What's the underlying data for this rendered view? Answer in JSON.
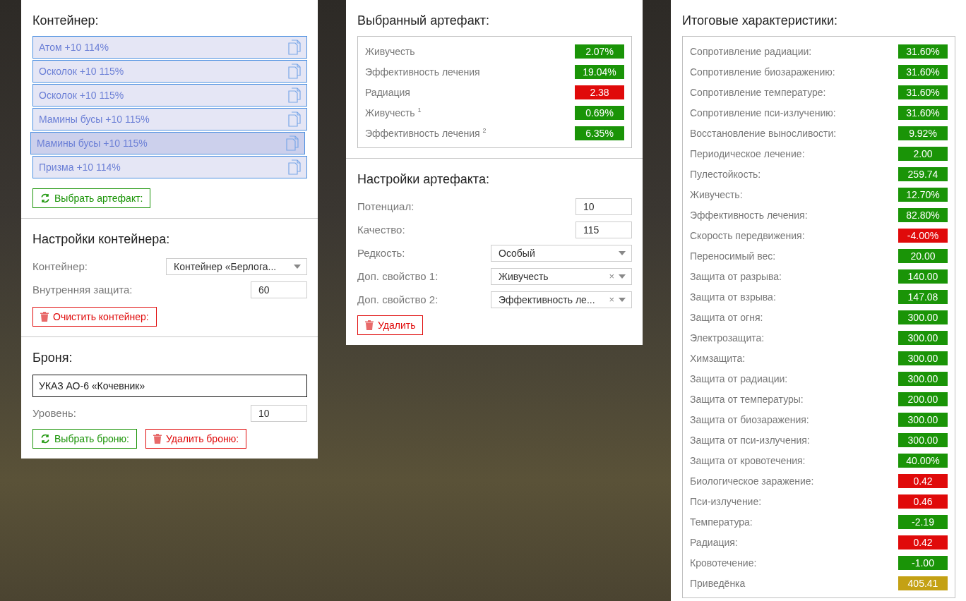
{
  "container": {
    "title": "Контейнер:",
    "artifacts": [
      {
        "label": "Атом +10 114%",
        "selected": false
      },
      {
        "label": "Осколок +10 115%",
        "selected": false
      },
      {
        "label": "Осколок +10 115%",
        "selected": false
      },
      {
        "label": "Мамины бусы +10 115%",
        "selected": false
      },
      {
        "label": "Мамины бусы +10 115%",
        "selected": true
      },
      {
        "label": "Призма +10 114%",
        "selected": false
      }
    ],
    "choose_button": "Выбрать артефакт:"
  },
  "container_settings": {
    "title": "Настройки контейнера:",
    "fields": [
      {
        "kind": "select",
        "label": "Контейнер:",
        "value": "Контейнер «Берлога..."
      },
      {
        "kind": "number",
        "label": "Внутренняя защита:",
        "value": "60"
      }
    ],
    "clear_button": "Очистить контейнер:"
  },
  "armor": {
    "title": "Броня:",
    "name": "УКАЗ АО-6 «Кочевник»",
    "level_label": "Уровень:",
    "level_value": "10",
    "choose_button": "Выбрать броню:",
    "delete_button": "Удалить броню:"
  },
  "selected_artifact": {
    "title": "Выбранный артефакт:",
    "stats": [
      {
        "label": "Живучесть",
        "value": "2.07%",
        "color": "#1a9407"
      },
      {
        "label": "Эффективность лечения",
        "value": "19.04%",
        "color": "#1a9407"
      },
      {
        "label": "Радиация",
        "value": "2.38",
        "color": "#e00a0a"
      },
      {
        "label": "Живучесть $^{1}$",
        "value": "0.69%",
        "color": "#1a9407"
      },
      {
        "label": "Эффективность лечения $^{2}$",
        "value": "6.35%",
        "color": "#1a9407"
      }
    ]
  },
  "artifact_settings": {
    "title": "Настройки артефакта:",
    "fields": [
      {
        "kind": "number",
        "label": "Потенциал:",
        "value": "10"
      },
      {
        "kind": "number",
        "label": "Качество:",
        "value": "115"
      },
      {
        "kind": "select",
        "label": "Редкость:",
        "value": "Особый"
      },
      {
        "kind": "clearable",
        "label": "Доп. свойство 1:",
        "value": "Живучесть",
        "clear": "×"
      },
      {
        "kind": "clearable",
        "label": "Доп. свойство 2:",
        "value": "Эффективность ле...",
        "clear": "×"
      }
    ],
    "delete_button": "Удалить"
  },
  "totals": {
    "title": "Итоговые характеристики:",
    "stats": [
      {
        "label": "Сопротивление радиации:",
        "value": "31.60%",
        "color": "#1a9407"
      },
      {
        "label": "Сопротивление биозаражению:",
        "value": "31.60%",
        "color": "#1a9407"
      },
      {
        "label": "Сопротивление температуре:",
        "value": "31.60%",
        "color": "#1a9407"
      },
      {
        "label": "Сопротивление пси-излучению:",
        "value": "31.60%",
        "color": "#1a9407"
      },
      {
        "label": "Восстановление выносливости:",
        "value": "9.92%",
        "color": "#1a9407"
      },
      {
        "label": "Периодическое лечение:",
        "value": "2.00",
        "color": "#1a9407"
      },
      {
        "label": "Пулестойкость:",
        "value": "259.74",
        "color": "#1a9407"
      },
      {
        "label": "Живучесть:",
        "value": "12.70%",
        "color": "#1a9407"
      },
      {
        "label": "Эффективность лечения:",
        "value": "82.80%",
        "color": "#1a9407"
      },
      {
        "label": "Скорость передвижения:",
        "value": "-4.00%",
        "color": "#e00a0a"
      },
      {
        "label": "Переносимый вес:",
        "value": "20.00",
        "color": "#1a9407"
      },
      {
        "label": "Защита от разрыва:",
        "value": "140.00",
        "color": "#1a9407"
      },
      {
        "label": "Защита от взрыва:",
        "value": "147.08",
        "color": "#1a9407"
      },
      {
        "label": "Защита от огня:",
        "value": "300.00",
        "color": "#1a9407"
      },
      {
        "label": "Электрозащита:",
        "value": "300.00",
        "color": "#1a9407"
      },
      {
        "label": "Химзащита:",
        "value": "300.00",
        "color": "#1a9407"
      },
      {
        "label": "Защита от радиации:",
        "value": "300.00",
        "color": "#1a9407"
      },
      {
        "label": "Защита от температуры:",
        "value": "200.00",
        "color": "#1a9407"
      },
      {
        "label": "Защита от биозаражения:",
        "value": "300.00",
        "color": "#1a9407"
      },
      {
        "label": "Защита от пси-излучения:",
        "value": "300.00",
        "color": "#1a9407"
      },
      {
        "label": "Защита от кровотечения:",
        "value": "40.00%",
        "color": "#1a9407"
      },
      {
        "label": "Биологическое заражение:",
        "value": "0.42",
        "color": "#e00a0a"
      },
      {
        "label": "Пси-излучение:",
        "value": "0.46",
        "color": "#e00a0a"
      },
      {
        "label": "Температура:",
        "value": "-2.19",
        "color": "#1a9407"
      },
      {
        "label": "Радиация:",
        "value": "0.42",
        "color": "#e00a0a"
      },
      {
        "label": "Кровотечение:",
        "value": "-1.00",
        "color": "#1a9407"
      },
      {
        "label": "Приведёнка",
        "value": "405.41",
        "color": "#c4a114"
      }
    ]
  }
}
